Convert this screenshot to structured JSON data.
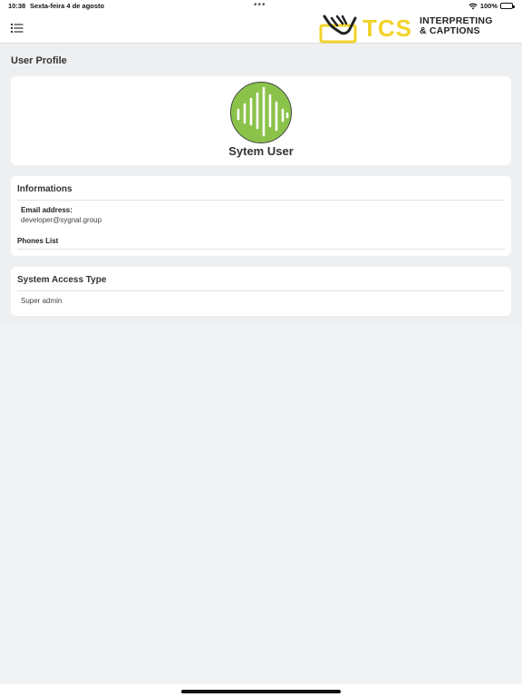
{
  "status_bar": {
    "time": "10:38",
    "date": "Sexta-feira 4 de agosto",
    "battery": "100%",
    "dots": "•••"
  },
  "header": {
    "menu_icon": "list-icon",
    "logo": {
      "brand": "TCS",
      "line1": "INTERPRETING",
      "line2": "& CAPTIONS",
      "brand_color": "#f2d32a"
    }
  },
  "page": {
    "title": "User Profile"
  },
  "profile": {
    "name": "Sytem User",
    "avatar_icon": "sound-wave-icon",
    "avatar_color": "#8bc34a"
  },
  "informations": {
    "title": "Informations",
    "email_label": "Email address:",
    "email_value": "developer@sygnal.group",
    "phones_label": "Phones List"
  },
  "access": {
    "title": "System Access Type",
    "value": "Super admin"
  }
}
